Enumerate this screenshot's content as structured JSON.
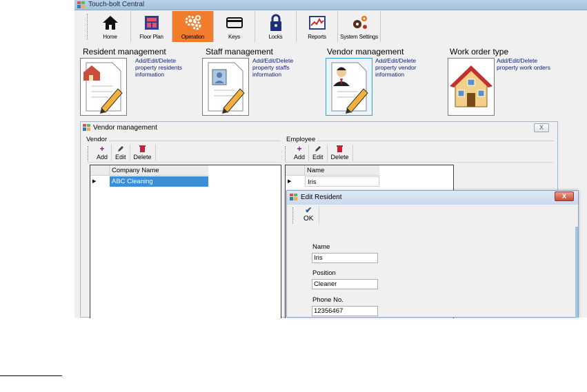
{
  "app": {
    "title": "Touch-bolt Central"
  },
  "ribbon": {
    "items": [
      {
        "label": "Home",
        "icon": "home-icon",
        "active": false
      },
      {
        "label": "Floor Plan",
        "icon": "floor-plan-icon",
        "active": false
      },
      {
        "label": "Operation",
        "icon": "gears-icon",
        "active": true
      },
      {
        "label": "Keys",
        "icon": "keycard-icon",
        "active": false
      },
      {
        "label": "Locks",
        "icon": "padlock-icon",
        "active": false
      },
      {
        "label": "Reports",
        "icon": "report-chart-icon",
        "active": false
      },
      {
        "label": "System Settings",
        "icon": "settings-gears-icon",
        "active": false
      }
    ]
  },
  "panels": [
    {
      "title": "Resident management",
      "description": "Add/Edit/Delete property residents information",
      "icon": "resident-document-icon"
    },
    {
      "title": "Staff management",
      "description": "Add/Edit/Delete property staffs information",
      "icon": "staff-document-icon"
    },
    {
      "title": "Vendor management",
      "description": "Add/Edit/Delete property vendor information",
      "icon": "vendor-document-icon"
    },
    {
      "title": "Work order type",
      "description": "Add/Edit/Delete property work orders",
      "icon": "house-icon"
    }
  ],
  "vendor_window": {
    "title": "Vendor management",
    "close_label": "X",
    "vendor_group": {
      "label": "Vendor",
      "toolbar": {
        "add": "Add",
        "edit": "Edit",
        "delete": "Delete"
      },
      "column_header": "Company Name",
      "rows": [
        "ABC Cleaning"
      ]
    },
    "employee_group": {
      "label": "Employee",
      "toolbar": {
        "add": "Add",
        "edit": "Edit",
        "delete": "Delete"
      },
      "column_header": "Name",
      "rows": [
        "Iris"
      ]
    }
  },
  "edit_dialog": {
    "title": "Edit Resident",
    "close_label": "X",
    "ok_label": "OK",
    "fields": {
      "name": {
        "label": "Name",
        "value": "Iris"
      },
      "position": {
        "label": "Position",
        "value": "Cleaner"
      },
      "phone": {
        "label": "Phone No.",
        "value": "12356467"
      }
    }
  },
  "colors": {
    "active_tab": "#f07c2c",
    "link_text": "#10217a",
    "selected_row": "#3c8ed6"
  }
}
